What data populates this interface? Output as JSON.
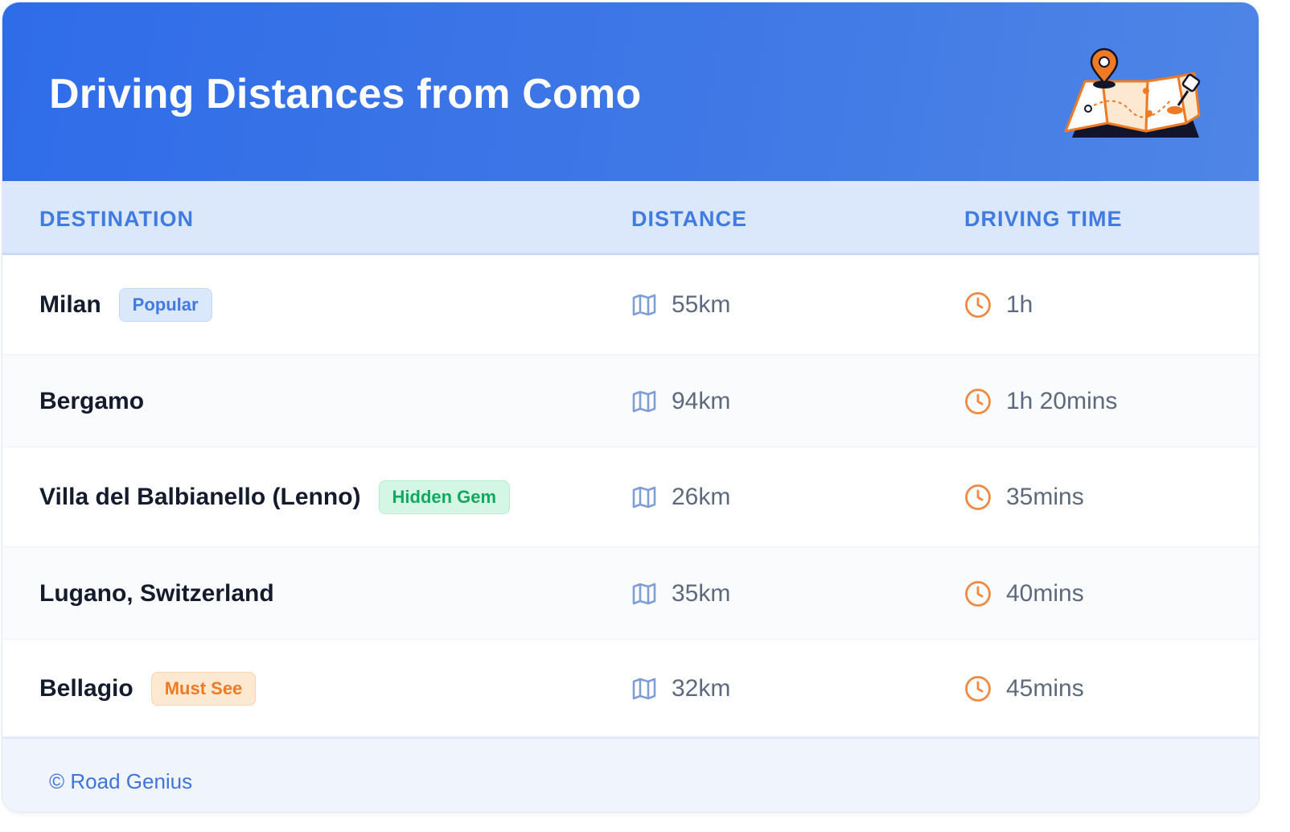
{
  "header": {
    "title": "Driving Distances from Como",
    "illustration_icon": "folded-map-with-pin-icon"
  },
  "table": {
    "columns": [
      "DESTINATION",
      "DISTANCE",
      "DRIVING TIME"
    ],
    "rows": [
      {
        "destination": "Milan",
        "badge": "Popular",
        "badge_type": "popular",
        "distance": "55km",
        "time": "1h"
      },
      {
        "destination": "Bergamo",
        "badge": "",
        "badge_type": "",
        "distance": "94km",
        "time": "1h 20mins"
      },
      {
        "destination": "Villa del Balbianello (Lenno)",
        "badge": "Hidden Gem",
        "badge_type": "gem",
        "distance": "26km",
        "time": "35mins"
      },
      {
        "destination": "Lugano, Switzerland",
        "badge": "",
        "badge_type": "",
        "distance": "35km",
        "time": "40mins"
      },
      {
        "destination": "Bellagio",
        "badge": "Must See",
        "badge_type": "must",
        "distance": "32km",
        "time": "45mins"
      }
    ],
    "distance_icon": "map-icon",
    "time_icon": "clock-icon"
  },
  "footer": {
    "copyright": "© Road Genius"
  },
  "colors": {
    "header_gradient_start": "#2f6ce8",
    "header_gradient_end": "#4e85e6",
    "accent_blue": "#3f7be0",
    "accent_orange": "#ee7a24",
    "accent_green": "#12a860"
  }
}
